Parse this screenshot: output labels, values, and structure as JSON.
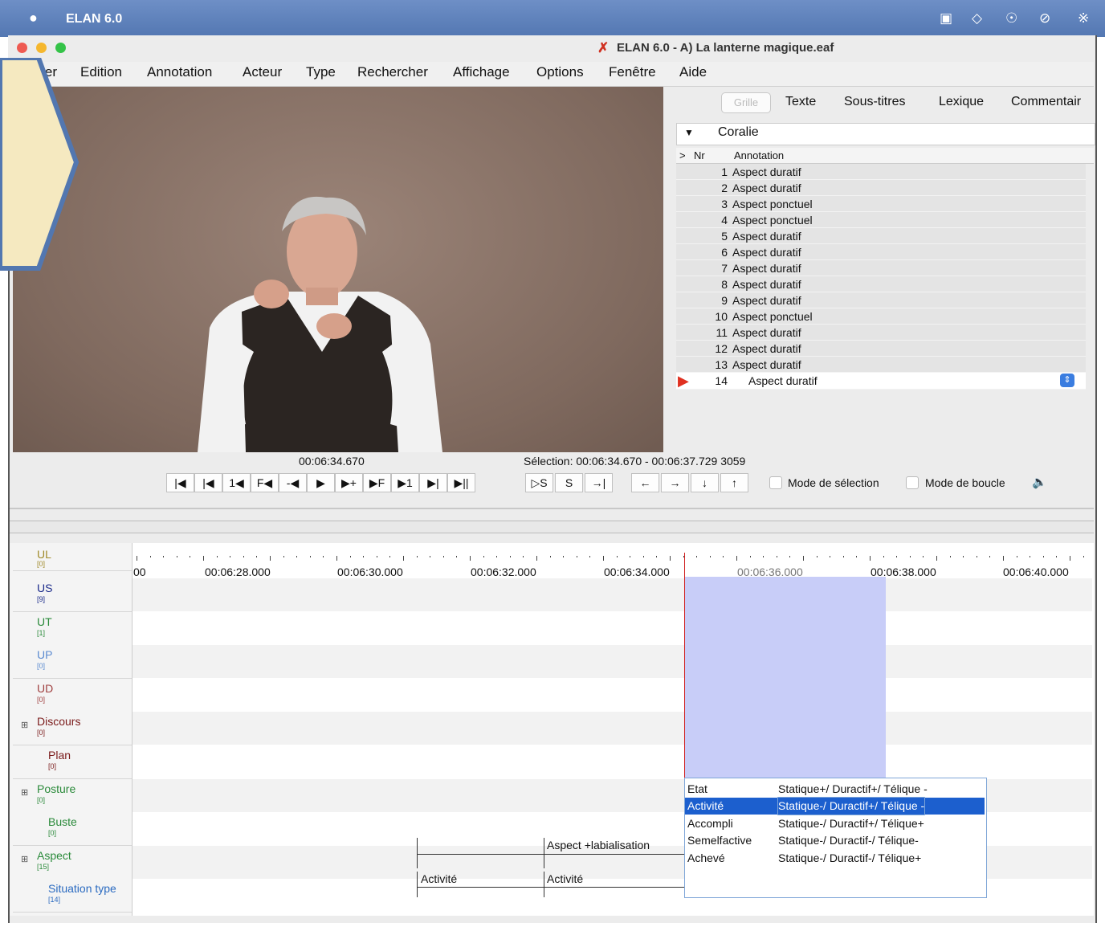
{
  "macbar": {
    "apple": "",
    "app_name": "ELAN 6.0"
  },
  "window": {
    "title": "ELAN 6.0 - A) La lanterne magique.eaf"
  },
  "menu": [
    "Fichier",
    "Edition",
    "Annotation",
    "Acteur",
    "Type",
    "Rechercher",
    "Affichage",
    "Options",
    "Fenêtre",
    "Aide"
  ],
  "tabs": {
    "grid": "Grille",
    "items": [
      "Texte",
      "Sous-titres",
      "Lexique",
      "Commentair"
    ]
  },
  "tier_selector": {
    "value": "Coralie"
  },
  "table": {
    "headers": {
      "arrow": ">",
      "nr": "Nr",
      "annotation": "Annotation"
    },
    "rows": [
      {
        "nr": "1",
        "ann": "Aspect duratif"
      },
      {
        "nr": "2",
        "ann": "Aspect duratif"
      },
      {
        "nr": "3",
        "ann": "Aspect ponctuel"
      },
      {
        "nr": "4",
        "ann": "Aspect ponctuel"
      },
      {
        "nr": "5",
        "ann": "Aspect duratif"
      },
      {
        "nr": "6",
        "ann": "Aspect duratif"
      },
      {
        "nr": "7",
        "ann": "Aspect duratif"
      },
      {
        "nr": "8",
        "ann": "Aspect duratif"
      },
      {
        "nr": "9",
        "ann": "Aspect duratif"
      },
      {
        "nr": "10",
        "ann": "Aspect ponctuel"
      },
      {
        "nr": "11",
        "ann": "Aspect duratif"
      },
      {
        "nr": "12",
        "ann": "Aspect duratif"
      },
      {
        "nr": "13",
        "ann": "Aspect duratif"
      }
    ],
    "current": {
      "nr": "14",
      "ann": "Aspect duratif"
    }
  },
  "media": {
    "time": "00:06:34.670",
    "selection": "Sélection: 00:06:34.670 - 00:06:37.729 3059"
  },
  "controls": {
    "buttons": [
      "|◀",
      "|◀",
      "1◀",
      "F◀",
      "-◀",
      "▶",
      "▶+",
      "▶F",
      "▶1",
      "▶|",
      "▶||"
    ],
    "sel_buttons": [
      "▷S",
      "S",
      "→|"
    ],
    "arrows": [
      "←",
      "→",
      "↓",
      "↑"
    ],
    "mode_selection": "Mode de sélection",
    "mode_boucle": "Mode de boucle"
  },
  "ruler": {
    "ticks": [
      "00",
      "00:06:28.000",
      "00:06:30.000",
      "00:06:32.000",
      "00:06:34.000",
      "00:06:36.000",
      "00:06:38.000",
      "00:06:40.000"
    ]
  },
  "tiers": [
    {
      "name": "UL",
      "count": "[0]",
      "color": "#a08a2a"
    },
    {
      "name": "US",
      "count": "[9]",
      "color": "#1a2a8a"
    },
    {
      "name": "UT",
      "count": "[1]",
      "color": "#2a8a3a"
    },
    {
      "name": "UP",
      "count": "[0]",
      "color": "#5a8ad0"
    },
    {
      "name": "UD",
      "count": "[0]",
      "color": "#a04040"
    },
    {
      "name": "Discours",
      "count": "[0]",
      "color": "#7a1a1a"
    },
    {
      "name": "Plan",
      "count": "[0]",
      "color": "#7a1a1a"
    },
    {
      "name": "Posture",
      "count": "[0]",
      "color": "#2a8a3a"
    },
    {
      "name": "Buste",
      "count": "[0]",
      "color": "#2a8a3a"
    },
    {
      "name": "Aspect",
      "count": "[15]",
      "color": "#2a8a3a"
    },
    {
      "name": "Situation type",
      "count": "[14]",
      "color": "#2a6ac0"
    }
  ],
  "annotations": {
    "aspect": "Aspect +labialisation",
    "situation_1": "Activité",
    "situation_2": "Activité"
  },
  "popup": [
    {
      "k": "Etat",
      "v": "Statique+/ Duractif+/ Télique -"
    },
    {
      "k": "Activité",
      "v": "Statique-/ Duractif+/ Télique -"
    },
    {
      "k": "Accompli",
      "v": "Statique-/ Duractif+/ Télique+"
    },
    {
      "k": "Semelfactive",
      "v": "Statique-/ Duractif-/ Télique-"
    },
    {
      "k": "Achevé",
      "v": "Statique-/ Duractif-/ Télique+"
    }
  ]
}
